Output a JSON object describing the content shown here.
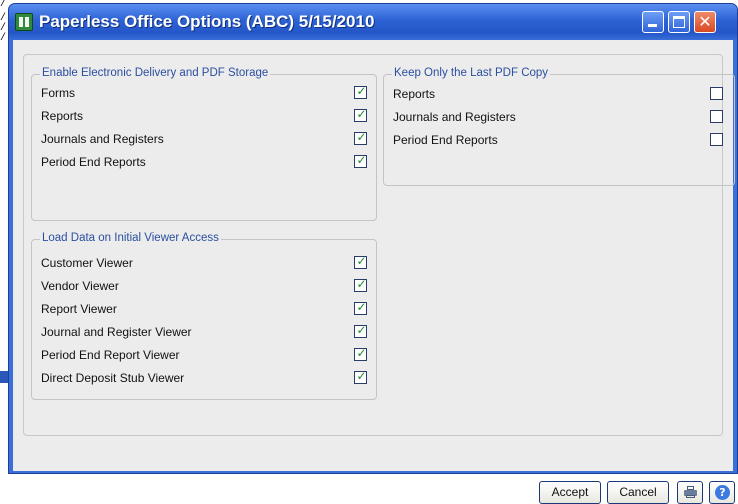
{
  "window": {
    "title": "Paperless Office Options (ABC) 5/15/2010",
    "close_glyph": "✕",
    "icon": "app-icon"
  },
  "groups": {
    "delivery": {
      "title": "Enable Electronic Delivery and PDF Storage",
      "items": [
        {
          "label": "Forms",
          "checked": true
        },
        {
          "label": "Reports",
          "checked": true
        },
        {
          "label": "Journals and Registers",
          "checked": true
        },
        {
          "label": "Period End Reports",
          "checked": true
        }
      ]
    },
    "viewer": {
      "title": "Load Data on Initial Viewer Access",
      "items": [
        {
          "label": "Customer Viewer",
          "checked": true
        },
        {
          "label": "Vendor Viewer",
          "checked": true
        },
        {
          "label": "Report Viewer",
          "checked": true
        },
        {
          "label": "Journal and Register Viewer",
          "checked": true
        },
        {
          "label": "Period End Report Viewer",
          "checked": true
        },
        {
          "label": "Direct Deposit Stub Viewer",
          "checked": true
        }
      ]
    },
    "lastcopy": {
      "title": "Keep Only the Last PDF Copy",
      "items": [
        {
          "label": "Reports",
          "checked": false
        },
        {
          "label": "Journals and Registers",
          "checked": false
        },
        {
          "label": "Period End Reports",
          "checked": false
        }
      ]
    }
  },
  "buttons": {
    "accept": "Accept",
    "cancel": "Cancel",
    "print_icon": "printer-icon",
    "help_icon": "help-icon",
    "help_glyph": "?"
  },
  "colors": {
    "titlebar": "#2d62d6",
    "group_title": "#2a4fa0",
    "check": "#1f8a2a"
  },
  "check_glyph": "✓"
}
